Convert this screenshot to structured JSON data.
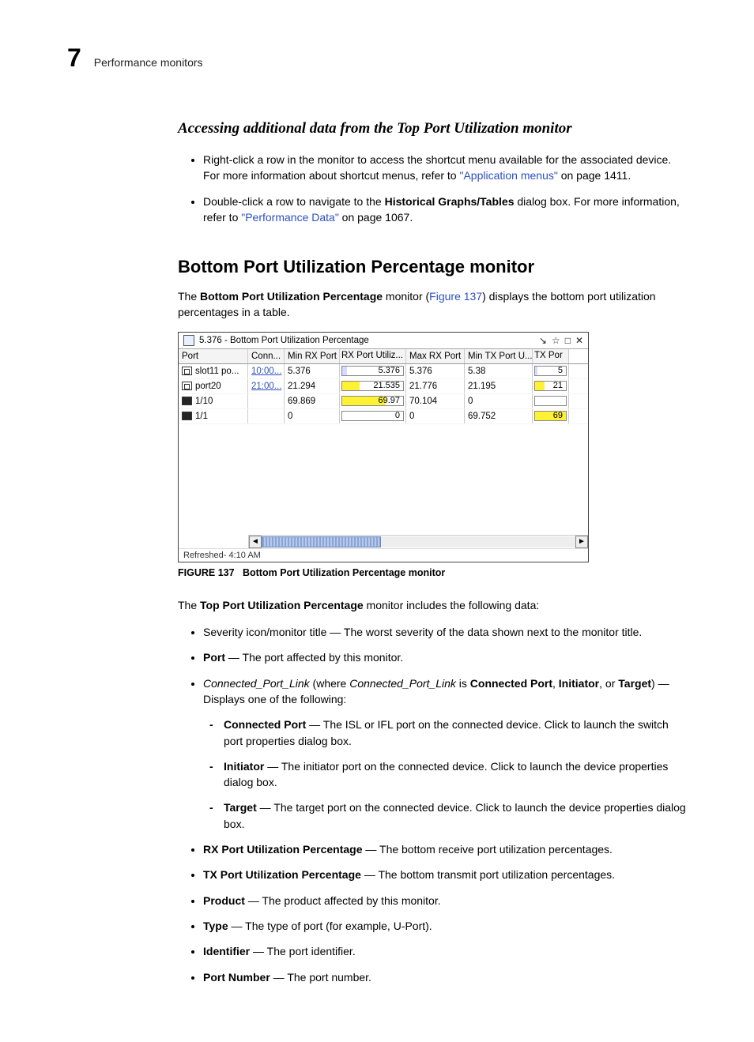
{
  "header": {
    "chapter": "7",
    "section": "Performance monitors"
  },
  "h3": "Accessing additional data from the Top Port Utilization monitor",
  "ul1": {
    "li1a": "Right-click a row in the monitor to access the shortcut menu available for the associated device. For more information about shortcut menus, refer to ",
    "li1link": "\"Application menus\"",
    "li1b": " on page 1411.",
    "li2a": "Double-click a row to navigate to the ",
    "li2bold": "Historical Graphs/Tables",
    "li2b": " dialog box. For more information, refer to ",
    "li2link": "\"Performance Data\"",
    "li2c": " on page 1067."
  },
  "h2": "Bottom Port Utilization Percentage monitor",
  "intro": {
    "a": "The ",
    "bold": "Bottom Port Utilization Percentage",
    "b": " monitor (",
    "link": "Figure 137",
    "c": ") displays the bottom port utilization percentages in a table."
  },
  "monitor": {
    "title": "5.376 - Bottom Port Utilization Percentage",
    "icons": [
      "pin-icon",
      "up-icon",
      "maximize-icon",
      "close-icon"
    ],
    "icon_glyphs": [
      "↘",
      "☆",
      "□",
      "✕"
    ],
    "cols": [
      "Port",
      "Conn...",
      "Min RX Port ...",
      "RX Port Utiliz...",
      "Max RX Port ...",
      "Min TX Port U...",
      "TX Por"
    ],
    "rows": [
      {
        "port": "slot11 po...",
        "icon": "card",
        "conn": "10:00...",
        "min": "5.376",
        "rx": "5.376",
        "rx_w": 8,
        "rx_c": "fill-blue",
        "max": "5.376",
        "mintx": "5.38",
        "tx": "5",
        "tx_w": 8,
        "tx_c": "fill-blue"
      },
      {
        "port": "port20",
        "icon": "card",
        "conn": "21:00...",
        "min": "21.294",
        "rx": "21.535",
        "rx_w": 28,
        "rx_c": "fill-yellow",
        "max": "21.776",
        "mintx": "21.195",
        "tx": "21",
        "tx_w": 30,
        "tx_c": "fill-yellow"
      },
      {
        "port": "1/10",
        "icon": "dark",
        "conn": "",
        "min": "69.869",
        "rx": "69.97",
        "rx_w": 72,
        "rx_c": "fill-yellow",
        "max": "70.104",
        "mintx": "0",
        "tx": "",
        "tx_w": 0,
        "tx_c": "fill-blue"
      },
      {
        "port": "1/1",
        "icon": "dark",
        "conn": "",
        "min": "0",
        "rx": "0",
        "rx_w": 0,
        "rx_c": "fill-blue",
        "max": "0",
        "mintx": "69.752",
        "tx": "69",
        "tx_w": 100,
        "tx_c": "fill-yellow"
      }
    ],
    "refreshed": "Refreshed- 4:10 AM"
  },
  "fig": {
    "label": "FIGURE 137",
    "text": "Bottom Port Utilization Percentage monitor"
  },
  "after_fig": {
    "a": "The ",
    "bold": "Top Port Utilization Percentage",
    "b": " monitor includes the following data:"
  },
  "fields": {
    "li1": "Severity icon/monitor title — The worst severity of the data shown next to the monitor title.",
    "li2": {
      "bold": "Port",
      "rest": " — The port affected by this monitor."
    },
    "li3": {
      "it1": "Connected_Port_Link",
      "mid1": " (where ",
      "it2": "Connected_Port_Link",
      "mid2": " is ",
      "b1": "Connected Port",
      "c1": ", ",
      "b2": "Initiator",
      "c2": ", or ",
      "b3": "Target",
      "c3": ") — Displays one of the following:"
    },
    "li3a": {
      "bold": "Connected Port",
      "rest": " — The ISL or IFL port on the connected device. Click to launch the switch port properties dialog box."
    },
    "li3b": {
      "bold": "Initiator",
      "rest": " — The initiator port on the connected device. Click to launch the device properties dialog box."
    },
    "li3c": {
      "bold": "Target",
      "rest": " — The target port on the connected device. Click to launch the device properties dialog box."
    },
    "li4": {
      "bold": "RX Port Utilization Percentage",
      "rest": " — The bottom receive port utilization percentages."
    },
    "li5": {
      "bold": "TX Port Utilization Percentage",
      "rest": " — The bottom transmit port utilization percentages."
    },
    "li6": {
      "bold": "Product",
      "rest": " — The product affected by this monitor."
    },
    "li7": {
      "bold": "Type",
      "rest": " — The type of port (for example, U-Port)."
    },
    "li8": {
      "bold": "Identifier",
      "rest": " — The port identifier."
    },
    "li9": {
      "bold": "Port Number",
      "rest": " — The port number."
    }
  }
}
